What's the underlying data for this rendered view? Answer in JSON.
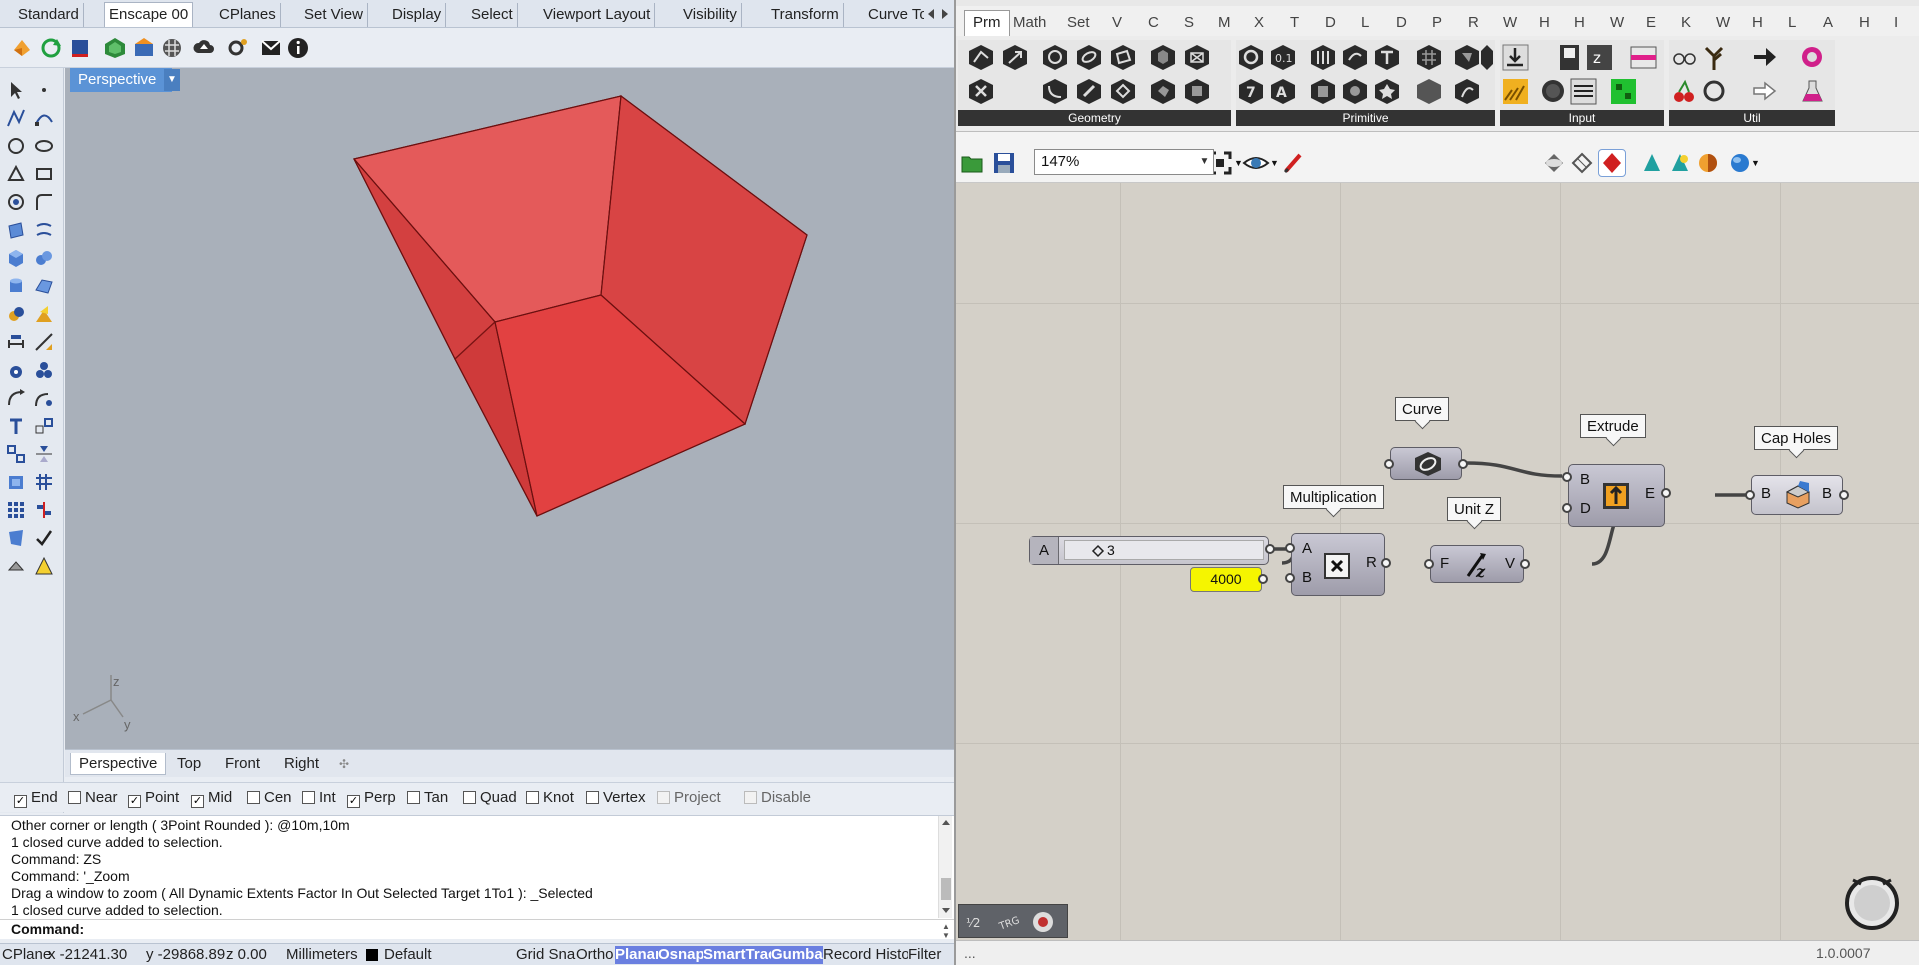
{
  "rhino": {
    "menu_tabs": [
      "Standard",
      "Enscape 00",
      "CPlanes",
      "Set View",
      "Display",
      "Select",
      "Viewport Layout",
      "Visibility",
      "Transform",
      "Curve To"
    ],
    "active_menu_tab": "Enscape 00",
    "viewport": {
      "title": "Perspective",
      "axes": {
        "x": "x",
        "y": "y",
        "z": "z"
      },
      "colors": {
        "background": "#a9b0ba",
        "box_face": "#e04848",
        "box_edge": "#6b1111"
      }
    },
    "viewport_tabs": [
      "Perspective",
      "Top",
      "Front",
      "Right"
    ],
    "active_viewport_tab": "Perspective",
    "osnaps": [
      {
        "label": "End",
        "checked": true,
        "enabled": true
      },
      {
        "label": "Near",
        "checked": false,
        "enabled": true
      },
      {
        "label": "Point",
        "checked": true,
        "enabled": true
      },
      {
        "label": "Mid",
        "checked": true,
        "enabled": true
      },
      {
        "label": "Cen",
        "checked": false,
        "enabled": true
      },
      {
        "label": "Int",
        "checked": false,
        "enabled": true
      },
      {
        "label": "Perp",
        "checked": true,
        "enabled": true
      },
      {
        "label": "Tan",
        "checked": false,
        "enabled": true
      },
      {
        "label": "Quad",
        "checked": false,
        "enabled": true
      },
      {
        "label": "Knot",
        "checked": false,
        "enabled": true
      },
      {
        "label": "Vertex",
        "checked": false,
        "enabled": true
      },
      {
        "label": "Project",
        "checked": false,
        "enabled": false
      },
      {
        "label": "Disable",
        "checked": false,
        "enabled": false
      }
    ],
    "command_history": [
      "Other corner or length ( 3Point  Rounded ): @10m,10m",
      "1 closed curve added to selection.",
      "Command: ZS",
      "Command: '_Zoom",
      "Drag a window to zoom ( All  Dynamic  Extents  Factor  In  Out  Selected  Target  1To1 ): _Selected",
      "1 closed curve added to selection."
    ],
    "command_prompt": "Command:",
    "status": {
      "cplane": "CPlane",
      "x": "x -21241.30",
      "y": "y -29868.89",
      "z": "z 0.00",
      "units": "Millimeters",
      "layer": "Default",
      "layer_color": "#000000",
      "toggles": [
        {
          "label": "Grid Snap",
          "on": false
        },
        {
          "label": "Ortho",
          "on": false
        },
        {
          "label": "Planar",
          "on": true
        },
        {
          "label": "Osnap",
          "on": true
        },
        {
          "label": "SmartTrack",
          "on": true
        },
        {
          "label": "Gumball",
          "on": true
        },
        {
          "label": "Record History",
          "on": false
        },
        {
          "label": "Filter",
          "on": false
        }
      ]
    }
  },
  "grasshopper": {
    "tabs": [
      "Prm",
      "Math",
      "Set",
      "V",
      "C",
      "S",
      "M",
      "X",
      "T",
      "D",
      "L",
      "D",
      "P",
      "R",
      "W",
      "H",
      "H",
      "W",
      "E",
      "K",
      "W",
      "H",
      "L",
      "A",
      "H",
      "I"
    ],
    "active_tab": "Prm",
    "ribbon_groups": [
      "Geometry",
      "Primitive",
      "Input",
      "Util"
    ],
    "zoom": "147%",
    "components": {
      "curve": {
        "label": "Curve"
      },
      "extrude": {
        "label": "Extrude",
        "inputs": [
          "B",
          "D"
        ],
        "output": "E"
      },
      "cap_holes": {
        "label": "Cap Holes",
        "input": "B",
        "output": "B"
      },
      "multiplication": {
        "label": "Multiplication",
        "inputs": [
          "A",
          "B"
        ],
        "output": "R"
      },
      "unit_z": {
        "label": "Unit Z",
        "input": "F",
        "output": "V"
      },
      "slider": {
        "name": "A",
        "value": "3"
      },
      "panel": {
        "value": "4000"
      }
    },
    "status_left": "...",
    "version": "1.0.0007"
  }
}
